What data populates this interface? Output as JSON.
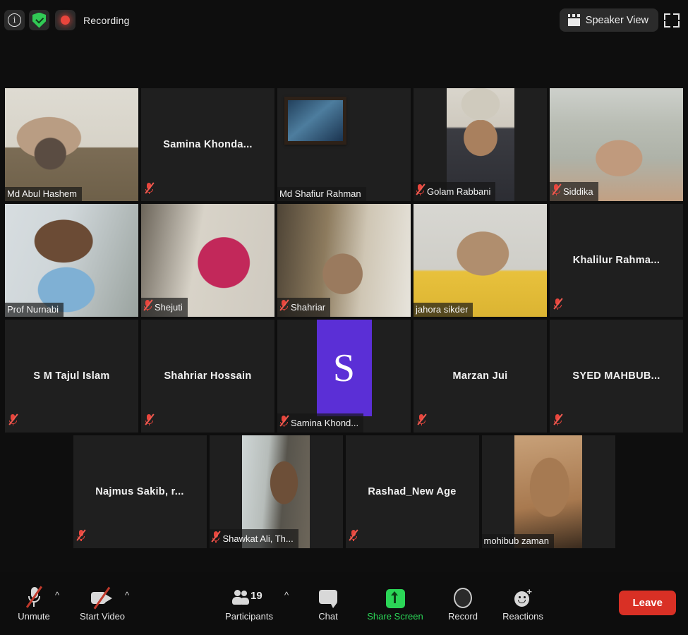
{
  "app": {
    "title": "Zoom Meeting"
  },
  "topbar": {
    "info_icon": "info-icon",
    "shield_icon": "encryption-shield-icon",
    "recording_icon": "recording-dot-icon",
    "recording_label": "Recording",
    "view_button_label": "Speaker View",
    "view_button_icon": "speaker-view-grid-icon",
    "fullscreen_icon": "fullscreen-expand-icon"
  },
  "grid": {
    "rows": [
      [
        {
          "name": "Md Abul Hashem",
          "video": true,
          "muted": false,
          "active_speaker": false,
          "label_position": "bottom-left",
          "video_fill": "full",
          "video_class": "v-hashem"
        },
        {
          "name": "Samina  Khonda...",
          "video": false,
          "muted": true,
          "active_speaker": false,
          "label_position": "center"
        },
        {
          "name": "Md Shafiur Rahman",
          "video": true,
          "muted": false,
          "active_speaker": false,
          "label_position": "bottom-left",
          "video_fill": "full",
          "video_class": "v-shafiur"
        },
        {
          "name": "Golam Rabbani",
          "video": true,
          "muted": true,
          "active_speaker": false,
          "label_position": "bottom-left",
          "video_fill": "portrait-w",
          "video_class": "v-rabbani"
        },
        {
          "name": "Siddika",
          "video": true,
          "muted": true,
          "active_speaker": false,
          "label_position": "bottom-left",
          "video_fill": "full",
          "video_class": "v-siddika"
        }
      ],
      [
        {
          "name": "Prof Nurnabi",
          "video": true,
          "muted": false,
          "active_speaker": true,
          "label_position": "bottom-left",
          "video_fill": "full",
          "video_class": "v-nurnabi"
        },
        {
          "name": "Shejuti",
          "video": true,
          "muted": true,
          "active_speaker": false,
          "label_position": "bottom-left",
          "video_fill": "full",
          "video_class": "v-shejuti"
        },
        {
          "name": "Shahriar",
          "video": true,
          "muted": true,
          "active_speaker": false,
          "label_position": "bottom-left",
          "video_fill": "full",
          "video_class": "v-shahriar"
        },
        {
          "name": "jahora sikder",
          "video": true,
          "muted": false,
          "active_speaker": false,
          "label_position": "bottom-left",
          "video_fill": "full",
          "video_class": "v-jahora"
        },
        {
          "name": "Khalilur  Rahma...",
          "video": false,
          "muted": true,
          "active_speaker": false,
          "label_position": "center"
        }
      ],
      [
        {
          "name": "S M Tajul Islam",
          "video": false,
          "muted": true,
          "active_speaker": false,
          "label_position": "center"
        },
        {
          "name": "Shahriar Hossain",
          "video": false,
          "muted": true,
          "active_speaker": false,
          "label_position": "center"
        },
        {
          "name": "Samina Khond...",
          "video": false,
          "muted": true,
          "active_speaker": false,
          "label_position": "bottom-left",
          "avatar_letter": "S",
          "avatar_color": "#5B2FD6"
        },
        {
          "name": "Marzan Jui",
          "video": false,
          "muted": true,
          "active_speaker": false,
          "label_position": "center"
        },
        {
          "name": "SYED MAHBUB...",
          "video": false,
          "muted": true,
          "active_speaker": false,
          "label_position": "center"
        }
      ],
      [
        {
          "name": "Najmus Sakib, r...",
          "video": false,
          "muted": true,
          "active_speaker": false,
          "label_position": "center"
        },
        {
          "name": "Shawkat Ali, Th...",
          "video": true,
          "muted": true,
          "active_speaker": false,
          "label_position": "bottom-left",
          "video_fill": "portrait-w",
          "video_class": "v-shawkat"
        },
        {
          "name": "Rashad_New Age",
          "video": false,
          "muted": true,
          "active_speaker": false,
          "label_position": "center"
        },
        {
          "name": "mohibub zaman",
          "video": true,
          "muted": false,
          "active_speaker": false,
          "label_position": "bottom-left",
          "video_fill": "portrait-w",
          "video_class": "v-mohibub"
        }
      ]
    ]
  },
  "toolbar": {
    "unmute_label": "Unmute",
    "start_video_label": "Start Video",
    "participants_label": "Participants",
    "participants_count": "19",
    "chat_label": "Chat",
    "share_screen_label": "Share Screen",
    "record_label": "Record",
    "reactions_label": "Reactions",
    "leave_label": "Leave",
    "share_screen_color": "#2bd657",
    "leave_color": "#d93025"
  }
}
